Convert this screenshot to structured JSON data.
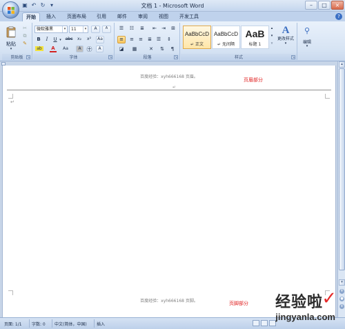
{
  "window": {
    "title": "文档 1 - Microsoft Word"
  },
  "tabs": [
    {
      "label": "开始",
      "active": true
    },
    {
      "label": "插入"
    },
    {
      "label": "页面布局"
    },
    {
      "label": "引用"
    },
    {
      "label": "邮件"
    },
    {
      "label": "审阅"
    },
    {
      "label": "视图"
    },
    {
      "label": "开发工具"
    }
  ],
  "ribbon": {
    "clipboard": {
      "paste": "粘贴",
      "label": "剪贴板"
    },
    "font": {
      "name": "微软雅黑",
      "size": "11",
      "label": "字体",
      "bold": "B",
      "italic": "I",
      "underline": "U",
      "strike": "abc",
      "subscript": "x₂",
      "superscript": "x²",
      "clear": "Aa",
      "highlight": "ab",
      "color": "A",
      "grow": "A",
      "shrink": "A",
      "change_case": "Aa",
      "char_border": "A",
      "char_shade": "A"
    },
    "paragraph": {
      "label": "段落"
    },
    "styles": {
      "label": "样式",
      "items": [
        {
          "sample": "AaBbCcD",
          "name": "↵ 正文",
          "selected": true
        },
        {
          "sample": "AaBbCcD",
          "name": "↵ 无间隔"
        },
        {
          "sample": "AaB",
          "name": "标题 1"
        }
      ],
      "change": "更改样式"
    },
    "editing": {
      "label": "编辑"
    }
  },
  "document": {
    "header_text": "百度经验：xyh666168 页眉。",
    "header_tag": "页眉部分",
    "paragraph_mark": "↵",
    "header_para_mark": "↵",
    "footer_text": "百度经验：xyh666168 页脚。",
    "footer_tag": "页脚部分"
  },
  "statusbar": {
    "page": "页面: 1/1",
    "words": "字数: 0",
    "language": "中文(简体，中国)",
    "mode": "插入"
  },
  "watermark": {
    "text": "经验啦",
    "check": "✓",
    "url": "jingyanla.com"
  },
  "colors": {
    "accent_red": "#e02020",
    "ribbon_bg": "#dfe9f6",
    "frame_bg": "#c7d5e8"
  }
}
